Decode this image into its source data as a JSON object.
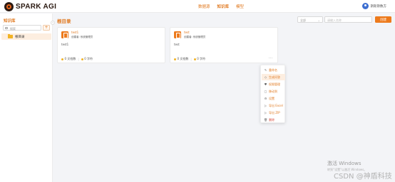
{
  "app": {
    "logo_text": "SPARK AGI"
  },
  "nav": {
    "items": [
      {
        "label": "数据源"
      },
      {
        "label": "知识库"
      },
      {
        "label": "模型"
      }
    ]
  },
  "user": {
    "name": "斯斯斯数方"
  },
  "sidebar": {
    "title": "知识库",
    "search_placeholder": "搜索",
    "add_label": "+",
    "collapse_label": "‹",
    "tree": [
      {
        "label": "根目录"
      }
    ]
  },
  "main": {
    "title": "根目录",
    "filter_value": "全部",
    "filter_chevron": "⌄",
    "search_placeholder": "请输入名称",
    "create_label": "创建",
    "cards": [
      {
        "name": "test1",
        "meta": "创建者: 系统管理员",
        "desc": "test1",
        "stat_docs": "0 文档数",
        "stat_chars": "0 字符",
        "more": ""
      },
      {
        "name": "test",
        "meta": "创建者: 系统管理员",
        "desc": "test",
        "stat_docs": "0 文档数",
        "stat_chars": "0 字符",
        "more": "···"
      }
    ]
  },
  "context_menu": {
    "items": [
      {
        "label": "重命名",
        "icon": "edit-icon"
      },
      {
        "label": "生成问答",
        "icon": "qa-icon"
      },
      {
        "label": "权限管理",
        "icon": "lock-icon"
      },
      {
        "label": "移动到",
        "icon": "move-icon"
      },
      {
        "label": "设置",
        "icon": "gear-icon"
      },
      {
        "label": "导出 Excel",
        "icon": "export-icon"
      },
      {
        "label": "导出 ZIP",
        "icon": "export-icon"
      },
      {
        "label": "删除",
        "icon": "trash-icon"
      }
    ]
  },
  "watermark": {
    "line1": "激活 Windows",
    "line2": "转到“设置”以激活 Windows。"
  },
  "csdn": "CSDN @神盾科技",
  "colors": {
    "brand": "#ed7a1c",
    "accent_text": "#e0781e",
    "danger": "#d94b3c",
    "hover_bg": "#fdeee0"
  }
}
